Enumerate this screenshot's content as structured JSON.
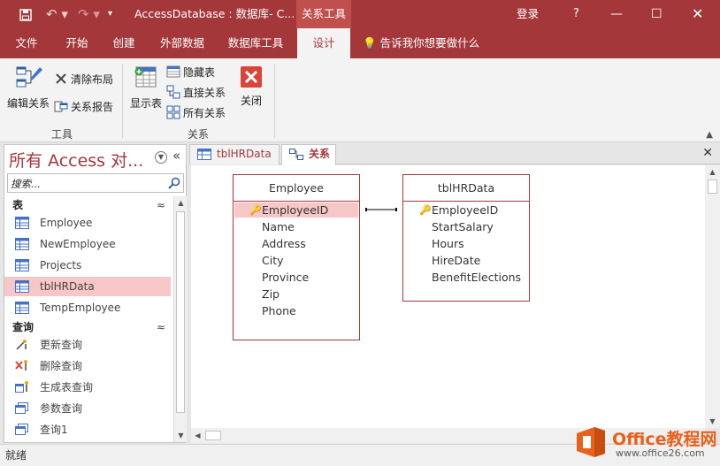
{
  "titlebar": {
    "title": "AccessDatabase : 数据库- C...",
    "context_tab": "关系工具",
    "login": "登录",
    "help": "?"
  },
  "ribbon_tabs": [
    {
      "label": "文件"
    },
    {
      "label": "开始"
    },
    {
      "label": "创建"
    },
    {
      "label": "外部数据"
    },
    {
      "label": "数据库工具"
    },
    {
      "label": "设计",
      "active": true
    }
  ],
  "tell_me": "告诉我你想要做什么",
  "ribbon": {
    "tools": {
      "edit_relationships": "编辑关系",
      "clear_layout": "清除布局",
      "relationship_report": "关系报告",
      "group_label": "工具"
    },
    "relationships": {
      "show_table": "显示表",
      "hide_table": "隐藏表",
      "direct_relationships": "直接关系",
      "all_relationships": "所有关系",
      "close": "关闭",
      "group_label": "关系"
    }
  },
  "nav": {
    "title": "所有 Access 对...",
    "search_placeholder": "搜索...",
    "groups": [
      {
        "label": "表",
        "items": [
          "Employee",
          "NewEmployee",
          "Projects",
          "tblHRData",
          "TempEmployee"
        ],
        "selected": "tblHRData"
      },
      {
        "label": "查询",
        "items": [
          "更新查询",
          "删除查询",
          "生成表查询",
          "参数查询",
          "查询1"
        ]
      }
    ]
  },
  "doc_tabs": [
    {
      "label": "tblHRData"
    },
    {
      "label": "关系",
      "active": true
    }
  ],
  "relationships_tables": [
    {
      "name": "Employee",
      "fields": [
        "EmployeeID",
        "Name",
        "Address",
        "City",
        "Province",
        "Zip",
        "Phone"
      ],
      "key_field": "EmployeeID"
    },
    {
      "name": "tblHRData",
      "fields": [
        "EmployeeID",
        "StartSalary",
        "Hours",
        "HireDate",
        "BenefitElections"
      ],
      "key_field": "EmployeeID"
    }
  ],
  "status": "就绪",
  "watermark": {
    "line1": "Office教程网",
    "line2": "www.office26.com"
  },
  "colors": {
    "accent": "#a4373a",
    "selection": "#f7c6c7"
  }
}
